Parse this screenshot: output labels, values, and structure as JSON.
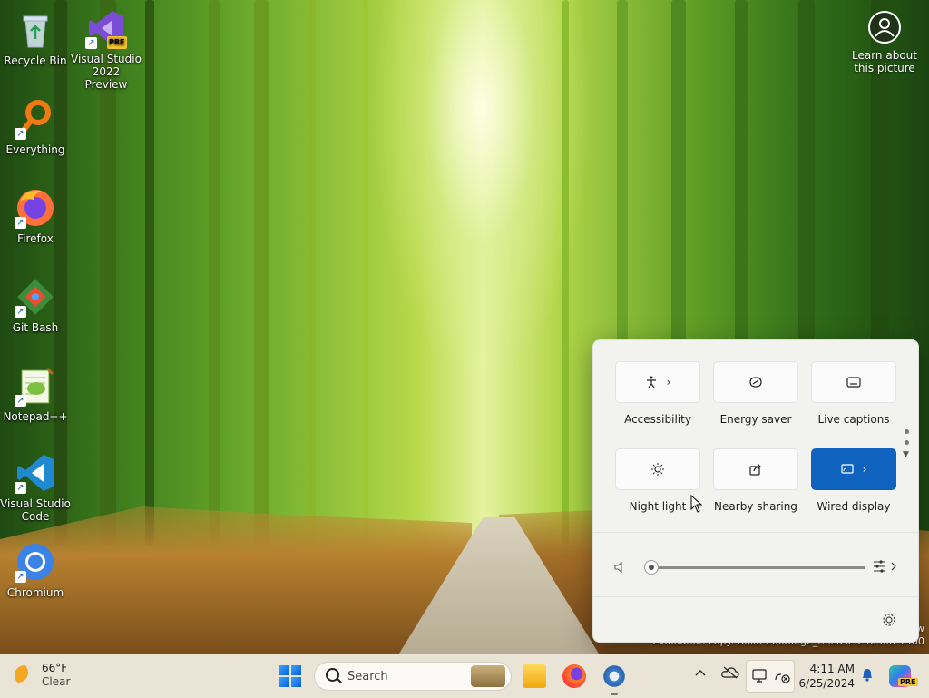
{
  "desktop": {
    "icons": [
      {
        "label": "Recycle Bin"
      },
      {
        "label": "Visual Studio 2022 Preview",
        "line1": "Visual Studio",
        "line2": "2022 Preview",
        "badge": "PRE"
      },
      {
        "label": "Everything"
      },
      {
        "label": "Firefox"
      },
      {
        "label": "Git Bash"
      },
      {
        "label": "Notepad++"
      },
      {
        "label": "Visual Studio Code",
        "line1": "Visual Studio",
        "line2": "Code"
      },
      {
        "label": "Chromium"
      }
    ],
    "learn_about": {
      "line1": "Learn about",
      "line2": "this picture"
    },
    "watermark": "Evaluation copy. Build 26080.ge_release.240308-1400",
    "watermark_partial": "w"
  },
  "quick_settings": {
    "tiles": [
      {
        "label": "Accessibility",
        "icon": "accessibility-icon",
        "has_chevron": true,
        "active": false
      },
      {
        "label": "Energy saver",
        "icon": "energy-saver-icon",
        "has_chevron": false,
        "active": false
      },
      {
        "label": "Live captions",
        "icon": "live-captions-icon",
        "has_chevron": false,
        "active": false
      },
      {
        "label": "Night light",
        "icon": "night-light-icon",
        "has_chevron": false,
        "active": false
      },
      {
        "label": "Nearby sharing",
        "icon": "nearby-sharing-icon",
        "has_chevron": false,
        "active": false
      },
      {
        "label": "Wired display",
        "icon": "wired-display-icon",
        "has_chevron": true,
        "active": true
      }
    ],
    "volume": {
      "level": 0,
      "icon": "volume-muted-icon"
    },
    "colors": {
      "active_tile": "#0f62be",
      "panel_bg": "#f2f3ee"
    }
  },
  "taskbar": {
    "weather": {
      "temp": "66°F",
      "condition": "Clear",
      "icon": "moon-icon"
    },
    "search": {
      "placeholder": "Search"
    },
    "pinned_apps": [
      "file-explorer-icon",
      "firefox-icon",
      "settings-icon"
    ],
    "clock": {
      "time": "4:11 AM",
      "date": "6/25/2024"
    },
    "copilot_badge": "PRE",
    "tray_icons": [
      "chevron-up-icon",
      "onedrive-offline-icon",
      "display-icon",
      "network-disconnected-icon",
      "bell-icon"
    ]
  }
}
